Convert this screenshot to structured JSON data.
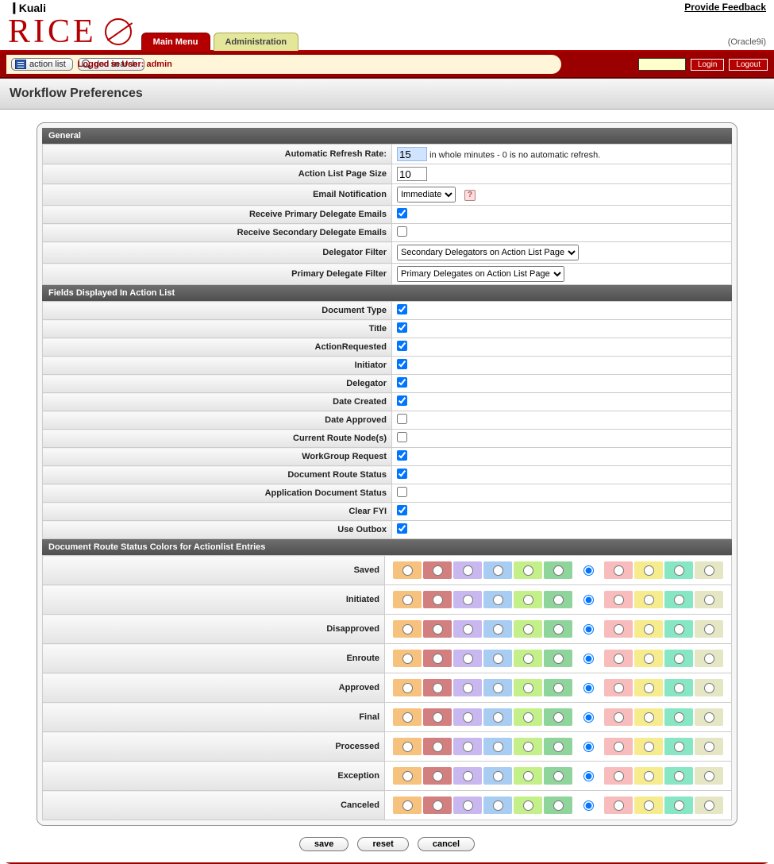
{
  "logo_text": "Kuali",
  "brand_text": "RICE",
  "feedback_link": "Provide Feedback",
  "env_label": "(Oracle9i)",
  "tabs": {
    "main": "Main Menu",
    "admin": "Administration"
  },
  "toolbar": {
    "action_list": "action list",
    "doc_search": "doc search"
  },
  "logged_in_label": "Logged in User: admin",
  "auth": {
    "login": "Login",
    "logout": "Logout"
  },
  "page_title": "Workflow Preferences",
  "sections": {
    "general": "General",
    "fields": "Fields Displayed In Action List",
    "colors": "Document Route Status Colors for Actionlist Entries"
  },
  "general": {
    "refresh_label": "Automatic Refresh Rate:",
    "refresh_value": "15",
    "refresh_hint": "in whole minutes - 0 is no automatic refresh.",
    "page_size_label": "Action List Page Size",
    "page_size_value": "10",
    "email_label": "Email Notification",
    "email_value": "Immediate",
    "primary_del_label": "Receive Primary Delegate Emails",
    "secondary_del_label": "Receive Secondary Delegate Emails",
    "delegator_filter_label": "Delegator Filter",
    "delegator_filter_value": "Secondary Delegators on Action List Page",
    "primary_filter_label": "Primary Delegate Filter",
    "primary_filter_value": "Primary Delegates on Action List Page"
  },
  "fields": [
    {
      "label": "Document Type",
      "checked": true
    },
    {
      "label": "Title",
      "checked": true
    },
    {
      "label": "ActionRequested",
      "checked": true
    },
    {
      "label": "Initiator",
      "checked": true
    },
    {
      "label": "Delegator",
      "checked": true
    },
    {
      "label": "Date Created",
      "checked": true
    },
    {
      "label": "Date Approved",
      "checked": false
    },
    {
      "label": "Current Route Node(s)",
      "checked": false
    },
    {
      "label": "WorkGroup Request",
      "checked": true
    },
    {
      "label": "Document Route Status",
      "checked": true
    },
    {
      "label": "Application Document Status",
      "checked": false
    },
    {
      "label": "Clear FYI",
      "checked": true
    },
    {
      "label": "Use Outbox",
      "checked": true
    }
  ],
  "color_rows": [
    {
      "label": "Saved",
      "selected": 6
    },
    {
      "label": "Initiated",
      "selected": 6
    },
    {
      "label": "Disapproved",
      "selected": 6
    },
    {
      "label": "Enroute",
      "selected": 6
    },
    {
      "label": "Approved",
      "selected": 6
    },
    {
      "label": "Final",
      "selected": 6
    },
    {
      "label": "Processed",
      "selected": 6
    },
    {
      "label": "Exception",
      "selected": 6
    },
    {
      "label": "Canceled",
      "selected": 6
    }
  ],
  "color_names": [
    "orange",
    "red",
    "purple",
    "blue",
    "lime",
    "green",
    "white",
    "pink",
    "yellow",
    "teal",
    "tan"
  ],
  "buttons": {
    "save": "save",
    "reset": "reset",
    "cancel": "cancel"
  }
}
